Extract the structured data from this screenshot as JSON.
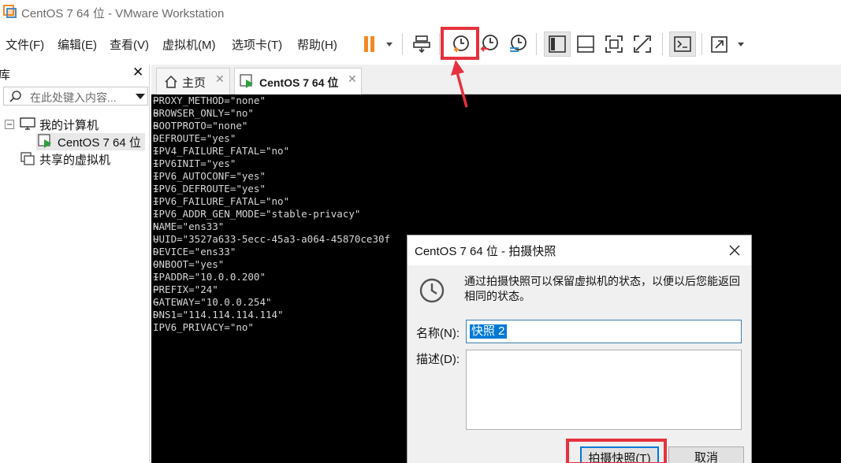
{
  "window": {
    "title": "CentOS 7 64 位 - VMware Workstation"
  },
  "menu": [
    {
      "label": "文件(F)"
    },
    {
      "label": "编辑(E)"
    },
    {
      "label": "查看(V)"
    },
    {
      "label": "虚拟机(M)"
    },
    {
      "label": "选项卡(T)"
    },
    {
      "label": "帮助(H)"
    }
  ],
  "toolbar": {
    "buttons": [
      "pause-icon",
      "send-ctrl-alt-del-icon",
      "take-snapshot-icon",
      "revert-snapshot-icon",
      "snapshot-manager-icon",
      "show-library-icon",
      "show-thumbnail-bar-icon",
      "full-screen-icon",
      "unity-icon",
      "console-view-icon",
      "stretch-guest-icon"
    ],
    "accent": "#f08a24"
  },
  "library": {
    "title": "库",
    "search_placeholder": "在此处键入内容...",
    "tree": [
      {
        "label": "我的计算机"
      },
      {
        "label": "CentOS 7 64 位"
      },
      {
        "label": "共享的虚拟机"
      }
    ]
  },
  "tabs": [
    {
      "label": "主页"
    },
    {
      "label": "CentOS 7 64 位"
    }
  ],
  "console": {
    "lines": [
      "PROXY_METHOD=\"none\"",
      "BROWSER_ONLY=\"no\"",
      "BOOTPROTO=\"none\"",
      "DEFROUTE=\"yes\"",
      "IPV4_FAILURE_FATAL=\"no\"",
      "IPV6INIT=\"yes\"",
      "IPV6_AUTOCONF=\"yes\"",
      "IPV6_DEFROUTE=\"yes\"",
      "IPV6_FAILURE_FATAL=\"no\"",
      "IPV6_ADDR_GEN_MODE=\"stable-privacy\"",
      "NAME=\"ens33\"",
      "UUID=\"3527a633-5ecc-45a3-a064-45870ce30f",
      "DEVICE=\"ens33\"",
      "ONBOOT=\"yes\"",
      "IPADDR=\"10.0.0.200\"",
      "PREFIX=\"24\"",
      "GATEWAY=\"10.0.0.254\"",
      "DNS1=\"114.114.114.114\"",
      "IPV6_PRIVACY=\"no\""
    ],
    "tildes": "~\n~\n~\n~\n~\n~\n~\n~\n~\n~\n~\n~\n~\n~\n~\n~\n~\n~"
  },
  "dialog": {
    "title": "CentOS 7 64 位 - 拍摄快照",
    "message": "通过拍摄快照可以保留虚拟机的状态，以便以后您能返回相同的状态。",
    "name_label": "名称(N):",
    "name_value": "快照 2",
    "desc_label": "描述(D):",
    "desc_value": "",
    "ok_label": "拍摄快照(T)",
    "cancel_label": "取消"
  },
  "colors": {
    "highlight": "#e5323e",
    "console_bg": "#000000",
    "selection": "#0078d7"
  }
}
